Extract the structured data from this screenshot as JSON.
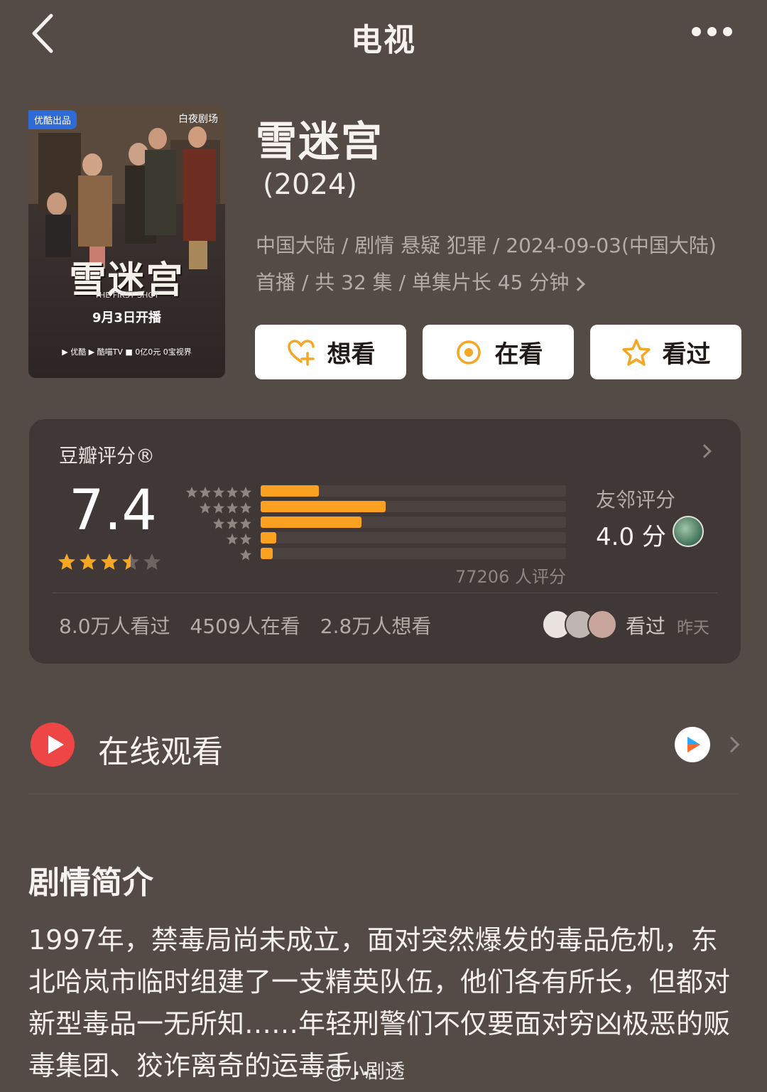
{
  "header": {
    "title": "电视",
    "back_icon": "chevron-left-icon",
    "more_icon": "more-dots-icon"
  },
  "poster": {
    "badge": "优酷出品",
    "brand": "白夜剧场",
    "title": "雪迷宫",
    "subtitle": "THE FIRST SHOT",
    "date": "9月3日开播",
    "platforms": "▶ 优酷  ▶ 酷喵TV  ■ 0亿0元  0宝视界"
  },
  "show": {
    "title": "雪迷宫",
    "year": "(2024)",
    "meta": "中国大陆 / 剧情 悬疑 犯罪 / 2024-09-03(中国大陆) 首播 / 共 32 集 / 单集片长 45 分钟"
  },
  "actions": [
    {
      "label": "想看",
      "icon": "heart-plus-icon"
    },
    {
      "label": "在看",
      "icon": "target-icon"
    },
    {
      "label": "看过",
      "icon": "star-outline-icon"
    }
  ],
  "rating": {
    "label": "豆瓣评分®",
    "score": "7.4",
    "stars": 3.5,
    "distribution": [
      0.19,
      0.41,
      0.33,
      0.05,
      0.04
    ],
    "count_text": "77206 人评分",
    "friend_label": "友邻评分",
    "friend_score": "4.0 分",
    "stats": [
      "8.0万人看过",
      "4509人在看",
      "2.8万人想看"
    ],
    "seen_label": "看过",
    "seen_time": "昨天",
    "accent_color": "#fba121"
  },
  "watch": {
    "label": "在线观看",
    "icon": "play-icon",
    "provider_icon": "youku-icon"
  },
  "synopsis": {
    "title": "剧情简介",
    "body": "1997年，禁毒局尚未成立，面对突然爆发的毒品危机，东北哈岚市临时组建了一支精英队伍，他们各有所长，但都对新型毒品一无所知……年轻刑警们不仅要面对穷凶极恶的贩毒集团、狡诈离奇的运毒手…"
  },
  "watermark": "@小剧透"
}
